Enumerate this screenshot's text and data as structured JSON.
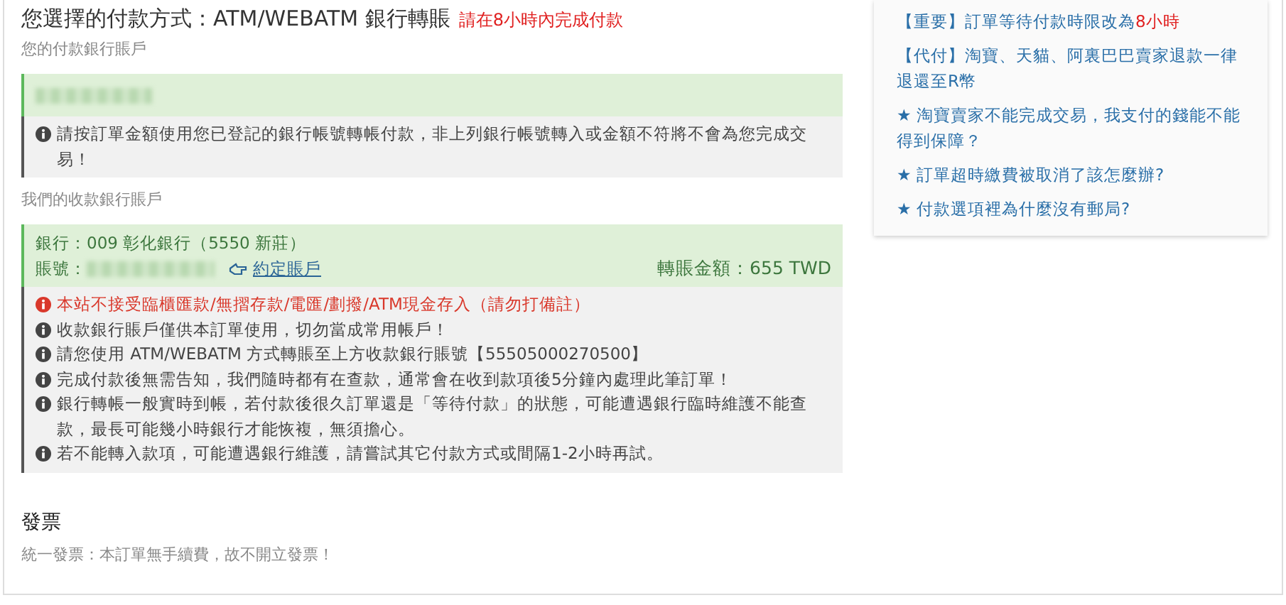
{
  "heading": {
    "title": "您選擇的付款方式：ATM/WEBATM 銀行轉賬",
    "deadline": "請在8小時內完成付款"
  },
  "payer": {
    "label": "您的付款銀行賬戶",
    "account_redacted": true,
    "notice": "請按訂單金額使用您已登記的銀行帳號轉帳付款，非上列銀行帳號轉入或金額不符將不會為您完成交易！"
  },
  "payee": {
    "label": "我們的收款銀行賬戶",
    "bank": "銀行：009 彰化銀行（5550 新莊）",
    "account_label": "賬號：",
    "account_redacted": true,
    "link": "約定賬戶",
    "amount": "轉賬金額：655 TWD",
    "notices": [
      {
        "kind": "warning",
        "text": "本站不接受臨櫃匯款/無摺存款/電匯/劃撥/ATM現金存入（請勿打備註）"
      },
      {
        "kind": "info",
        "text": "收款銀行賬戶僅供本訂單使用，切勿當成常用帳戶！"
      },
      {
        "kind": "info",
        "text": "請您使用 ATM/WEBATM 方式轉賬至上方收款銀行賬號【55505000270500】"
      },
      {
        "kind": "info",
        "text": "完成付款後無需告知，我們隨時都有在查款，通常會在收到款項後5分鐘內處理此筆訂單！"
      },
      {
        "kind": "info",
        "text": "銀行轉帳一般實時到帳，若付款後很久訂單還是「等待付款」的狀態，可能遭遇銀行臨時維護不能查款，最長可能幾小時銀行才能恢複，無須擔心。"
      },
      {
        "kind": "info",
        "text": "若不能轉入款項，可能遭遇銀行維護，請嘗試其它付款方式或間隔1-2小時再試。"
      }
    ]
  },
  "invoice": {
    "title": "發票",
    "text": "統一發票：本訂單無手續費，故不開立發票！"
  },
  "sidebar": {
    "links": [
      {
        "segments": [
          {
            "text": "【重要】訂單等待付款時限改為",
            "highlight": false
          },
          {
            "text": "8小時",
            "highlight": true
          }
        ]
      },
      {
        "segments": [
          {
            "text": "【代付】淘寶、天貓、阿裏巴巴賣家退款一律退還至R幣",
            "highlight": false
          }
        ]
      },
      {
        "segments": [
          {
            "text": "★ 淘寶賣家不能完成交易，我支付的錢能不能得到保障？",
            "highlight": false
          }
        ]
      },
      {
        "segments": [
          {
            "text": "★ 訂單超時繳費被取消了該怎麼辦?",
            "highlight": false
          }
        ]
      },
      {
        "segments": [
          {
            "text": "★ 付款選項裡為什麼沒有郵局?",
            "highlight": false
          }
        ]
      }
    ]
  }
}
